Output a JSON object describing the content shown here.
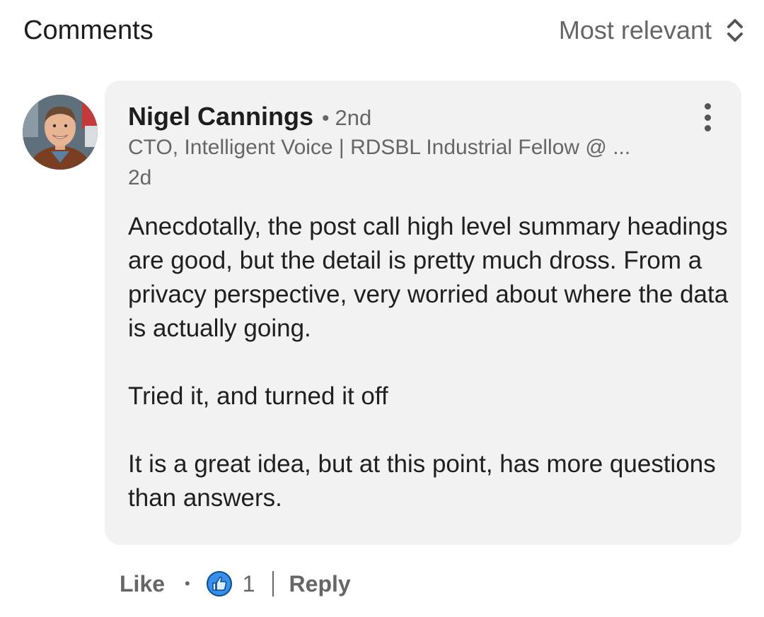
{
  "header": {
    "title": "Comments",
    "sort_label": "Most relevant"
  },
  "comment": {
    "author_name": "Nigel Cannings",
    "separator": "•",
    "degree": "2nd",
    "headline": "CTO, Intelligent Voice | RDSBL Industrial Fellow @ ...",
    "time": "2d",
    "paragraphs": [
      "Anecdotally, the post call high level summary headings are good, but the detail is pretty much dross.  From a privacy perspective, very worried about where the data is actually going.",
      "Tried it, and turned it off",
      "It is a great idea, but at this point, has more questions than answers."
    ]
  },
  "actions": {
    "like_label": "Like",
    "separator": "•",
    "reaction_count": "1",
    "reply_label": "Reply"
  },
  "colors": {
    "bubble_bg": "#f2f2f2",
    "like_blue": "#378fe9",
    "secondary_text": "#666666"
  }
}
